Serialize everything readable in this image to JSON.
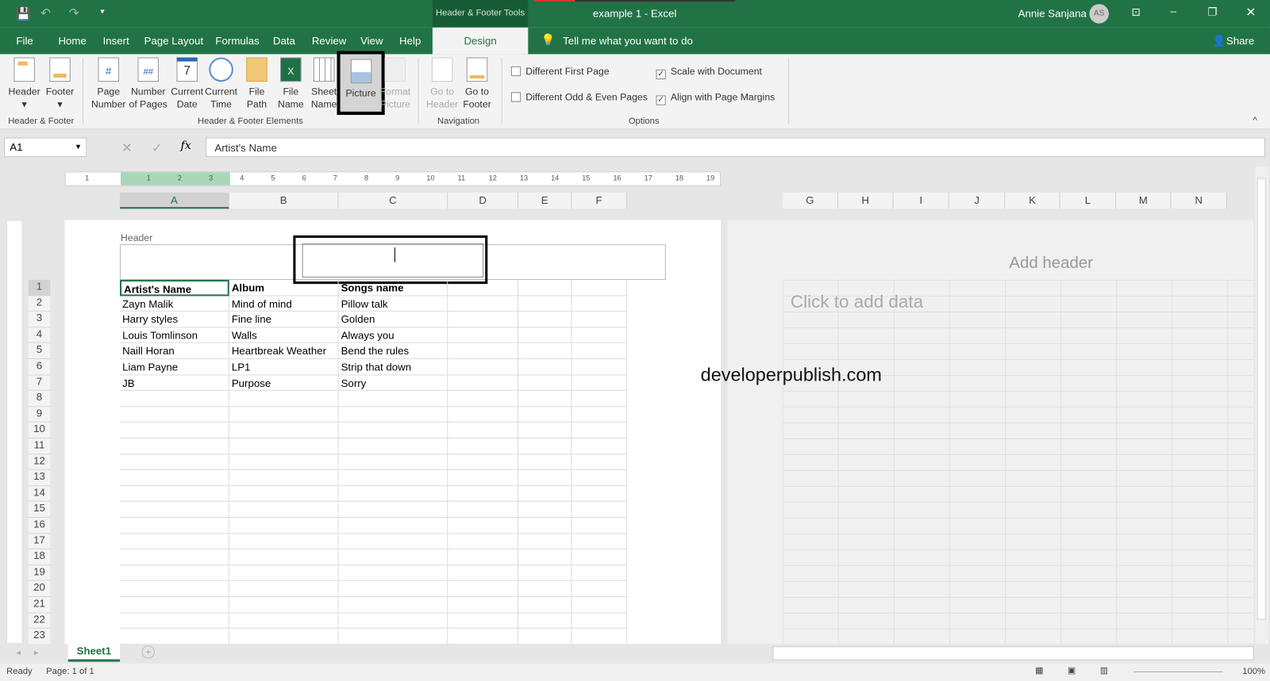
{
  "title": {
    "context_tools": "Header & Footer Tools",
    "doc": "example 1  -  Excel",
    "user": "Annie Sanjana",
    "initials": "AS"
  },
  "tabs": [
    "File",
    "Home",
    "Insert",
    "Page Layout",
    "Formulas",
    "Data",
    "Review",
    "View",
    "Help"
  ],
  "active_tab": "Design",
  "tell_me": "Tell me what you want to do",
  "share": "Share",
  "ribbon": {
    "header": "Header",
    "footer": "Footer",
    "page_number": [
      "Page",
      "Number"
    ],
    "number_of_pages": [
      "Number",
      "of Pages"
    ],
    "current_date": [
      "Current",
      "Date"
    ],
    "current_time": [
      "Current",
      "Time"
    ],
    "file_path": [
      "File",
      "Path"
    ],
    "file_name": [
      "File",
      "Name"
    ],
    "sheet_name": [
      "Sheet",
      "Name"
    ],
    "picture": "Picture",
    "format_picture": [
      "Format",
      "Picture"
    ],
    "go_to_header": [
      "Go to",
      "Header"
    ],
    "go_to_footer": [
      "Go to",
      "Footer"
    ],
    "groups": {
      "hf": "Header & Footer",
      "elements": "Header & Footer Elements",
      "nav": "Navigation",
      "options": "Options"
    },
    "options": [
      {
        "label": "Different First Page",
        "checked": false
      },
      {
        "label": "Different Odd & Even Pages",
        "checked": false
      },
      {
        "label": "Scale with Document",
        "checked": true
      },
      {
        "label": "Align with Page Margins",
        "checked": true
      }
    ]
  },
  "namebox": "A1",
  "formula": "Artist's Name",
  "ruler": [
    "1",
    "1",
    "2",
    "3",
    "4",
    "5",
    "6",
    "7",
    "8",
    "9",
    "10",
    "11",
    "12",
    "13",
    "14",
    "15",
    "16",
    "17",
    "18",
    "19"
  ],
  "columns_left": [
    "A",
    "B",
    "C",
    "D",
    "E",
    "F"
  ],
  "columns_right": [
    "G",
    "H",
    "I",
    "J",
    "K",
    "L",
    "M",
    "N"
  ],
  "header_label": "Header",
  "add_header": "Add header",
  "click_to_add": "Click to add data",
  "watermark": "developerpublish.com",
  "rows": [
    [
      "Artist's Name",
      "Album",
      "Songs name"
    ],
    [
      "Zayn Malik",
      "Mind of mind",
      "Pillow talk"
    ],
    [
      "Harry styles",
      "Fine line",
      "Golden"
    ],
    [
      "Louis Tomlinson",
      "Walls",
      "Always you"
    ],
    [
      "Naill Horan",
      "Heartbreak  Weather",
      "Bend the rules"
    ],
    [
      "Liam Payne",
      "LP1",
      "Strip that down"
    ],
    [
      "JB",
      "Purpose",
      "Sorry"
    ]
  ],
  "row_count": 23,
  "sheet_tab": "Sheet1",
  "status": {
    "ready": "Ready",
    "page": "Page: 1 of 1",
    "zoom": "100%"
  }
}
